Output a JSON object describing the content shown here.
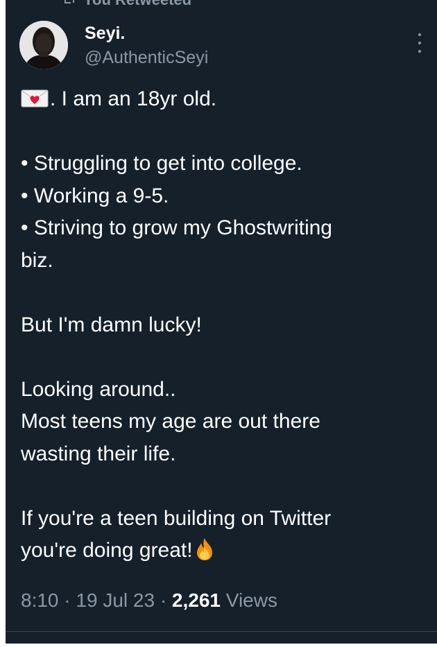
{
  "tweet": {
    "retweet_label": "You Retweeted",
    "author": {
      "name": "Seyi.",
      "handle": "@AuthenticSeyi"
    },
    "lines": {
      "l1": ". I am an 18yr old.",
      "l2": "• Struggling to get into college.",
      "l3": "• Working a 9-5.",
      "l4": "• Striving to grow my Ghostwriting",
      "l5": "biz.",
      "l6": "But I'm damn lucky!",
      "l7": "Looking around..",
      "l8": "Most teens my age are out there",
      "l9": "wasting their life.",
      "l10": "If you're a teen building on Twitter",
      "l11": "you're doing great!"
    },
    "icons": {
      "leading": "love-letter-icon",
      "trailing": "fire-icon"
    },
    "meta": {
      "time": "8:10",
      "separator": "·",
      "date": "19 Jul 23",
      "views_count": "2,261",
      "views_label": "Views"
    }
  },
  "colors": {
    "background": "#15202b",
    "text_primary": "#ffffff",
    "text_secondary": "#8b98a5",
    "divider": "#38444d"
  }
}
